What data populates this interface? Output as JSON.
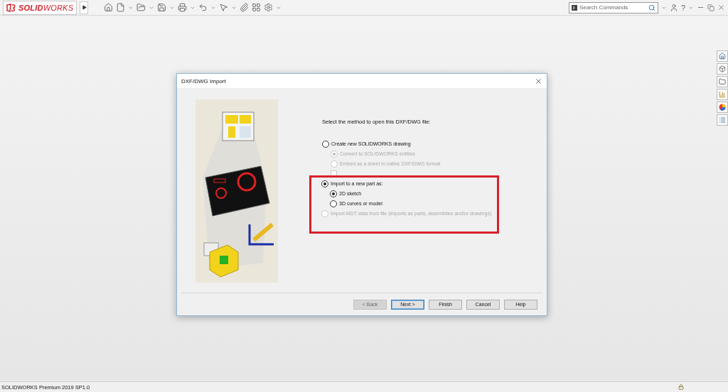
{
  "app": {
    "logo_text": "**SOLID**WORKS",
    "search": {
      "placeholder": "Search Commands"
    },
    "help_label": "?"
  },
  "dialog": {
    "title": "DXF/DWG Import",
    "prompt": "Select the method to open this DXF/DWG file:",
    "options": [
      {
        "label": "Create new SOLIDWORKS drawing",
        "selected": false,
        "disabled": false,
        "highlighted": false,
        "children": [
          {
            "kind": "radio",
            "label": "Convert to SOLIDWORKS entities",
            "selected": true,
            "disabled": true
          },
          {
            "kind": "radio",
            "label": "Embed as a sheet in native DXF/DWG format",
            "selected": false,
            "disabled": true
          },
          {
            "kind": "checkbox",
            "checked": false,
            "disabled": true
          }
        ]
      },
      {
        "label": "Import to a new part as:",
        "selected": true,
        "disabled": false,
        "highlighted": true,
        "children": [
          {
            "kind": "radio",
            "label": "2D sketch",
            "selected": true,
            "disabled": false
          },
          {
            "kind": "radio",
            "label": "3D curves or model",
            "selected": false,
            "disabled": false
          }
        ]
      },
      {
        "label": "Import MDT data from file (imports as parts, assemblies and/or drawings)",
        "selected": false,
        "disabled": true,
        "highlighted": true
      }
    ],
    "buttons": [
      {
        "label": "< Back",
        "disabled": true,
        "default": false
      },
      {
        "label": "Next >",
        "disabled": false,
        "default": true
      },
      {
        "label": "Finish",
        "disabled": false,
        "default": false
      },
      {
        "label": "Cancel",
        "disabled": false,
        "default": false
      },
      {
        "label": "Help",
        "disabled": false,
        "default": false
      }
    ]
  },
  "status_bar": {
    "text": "SOLIDWORKS Premium 2019 SP1.0"
  }
}
